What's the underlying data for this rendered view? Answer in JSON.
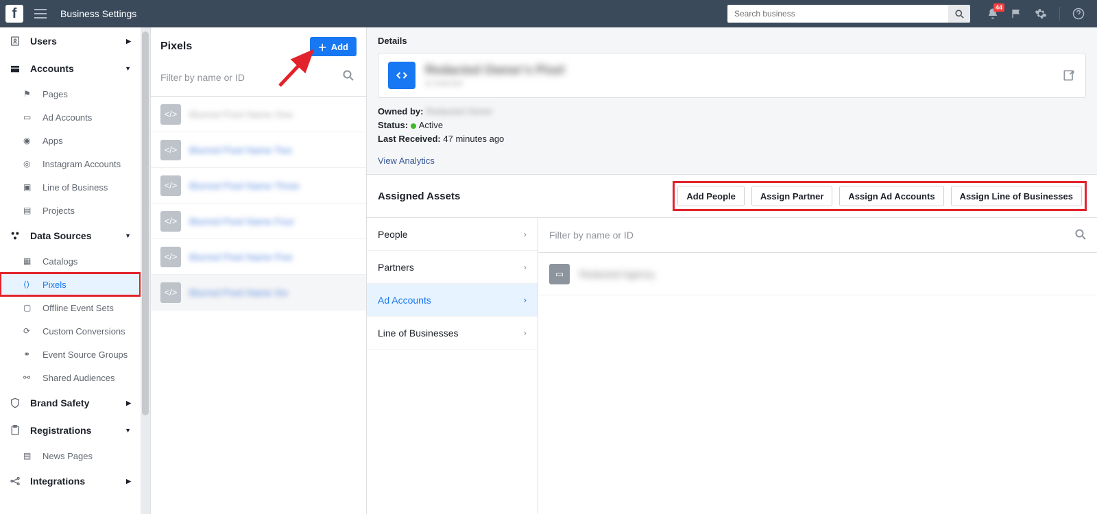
{
  "topbar": {
    "title": "Business Settings",
    "search_placeholder": "Search business",
    "notification_count": "44"
  },
  "sidebar": {
    "sections": [
      {
        "label": "Users",
        "caret": "right"
      },
      {
        "label": "Accounts",
        "caret": "down"
      },
      {
        "label": "Data Sources",
        "caret": "down"
      },
      {
        "label": "Brand Safety",
        "caret": "right"
      },
      {
        "label": "Registrations",
        "caret": "down"
      },
      {
        "label": "Integrations",
        "caret": "right"
      }
    ],
    "accounts": [
      {
        "label": "Pages"
      },
      {
        "label": "Ad Accounts"
      },
      {
        "label": "Apps"
      },
      {
        "label": "Instagram Accounts"
      },
      {
        "label": "Line of Business"
      },
      {
        "label": "Projects"
      }
    ],
    "data_sources": [
      {
        "label": "Catalogs"
      },
      {
        "label": "Pixels",
        "active": true
      },
      {
        "label": "Offline Event Sets"
      },
      {
        "label": "Custom Conversions"
      },
      {
        "label": "Event Source Groups"
      },
      {
        "label": "Shared Audiences"
      }
    ],
    "registrations": [
      {
        "label": "News Pages"
      }
    ]
  },
  "midcol": {
    "title": "Pixels",
    "add_label": "Add",
    "filter_placeholder": "Filter by name or ID",
    "items": [
      {
        "name": "Blurred Pixel Name One"
      },
      {
        "name": "Blurred Pixel Name Two",
        "selected": false
      },
      {
        "name": "Blurred Pixel Name Three"
      },
      {
        "name": "Blurred Pixel Name Four"
      },
      {
        "name": "Blurred Pixel Name Five"
      },
      {
        "name": "Blurred Pixel Name Six"
      }
    ]
  },
  "details": {
    "heading": "Details",
    "pixel_title": "Redacted Owner's Pixel",
    "pixel_subtitle": "id redacted",
    "owned_by_label": "Owned by:",
    "owned_by_value": "Redacted Owner",
    "status_label": "Status:",
    "status_value": "Active",
    "last_received_label": "Last Received:",
    "last_received_value": "47 minutes ago",
    "view_analytics": "View Analytics",
    "assigned_assets_title": "Assigned Assets",
    "buttons": {
      "add_people": "Add People",
      "assign_partner": "Assign Partner",
      "assign_ad_accounts": "Assign Ad Accounts",
      "assign_lob": "Assign Line of Businesses"
    },
    "tabs": [
      {
        "label": "People"
      },
      {
        "label": "Partners"
      },
      {
        "label": "Ad Accounts",
        "active": true
      },
      {
        "label": "Line of Businesses"
      }
    ],
    "assets_filter_placeholder": "Filter by name or ID",
    "asset_item_name": "Redacted Agency"
  }
}
